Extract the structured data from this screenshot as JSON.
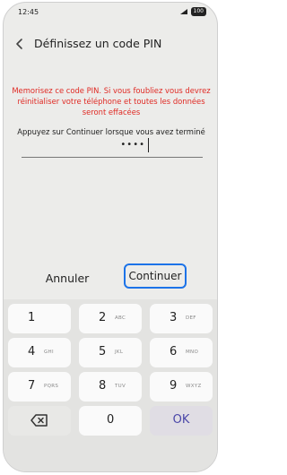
{
  "status_bar": {
    "time": "12:45",
    "battery": "100"
  },
  "header": {
    "title": "Définissez un code PIN"
  },
  "warning": "Memorisez ce code PIN. Si vous foubliez vous devrez réinitialiser votre téléphone et toutes les données seront effacées",
  "instruction": "Appuyez sur Continuer lorsque vous avez terminé",
  "pin": {
    "value": "••••"
  },
  "actions": {
    "cancel_label": "Annuler",
    "continue_label": "Continuer"
  },
  "keypad": {
    "keys": [
      {
        "digit": "1",
        "letters": ""
      },
      {
        "digit": "2",
        "letters": "ABC"
      },
      {
        "digit": "3",
        "letters": "DEF"
      },
      {
        "digit": "4",
        "letters": "GHI"
      },
      {
        "digit": "5",
        "letters": "JKL"
      },
      {
        "digit": "6",
        "letters": "MNO"
      },
      {
        "digit": "7",
        "letters": "PQRS"
      },
      {
        "digit": "8",
        "letters": "TUV"
      },
      {
        "digit": "9",
        "letters": "WXYZ"
      }
    ],
    "zero": "0",
    "ok_label": "OK"
  },
  "colors": {
    "warning": "#e02a24",
    "accent": "#1c73e8",
    "ok": "#4a46a8"
  }
}
